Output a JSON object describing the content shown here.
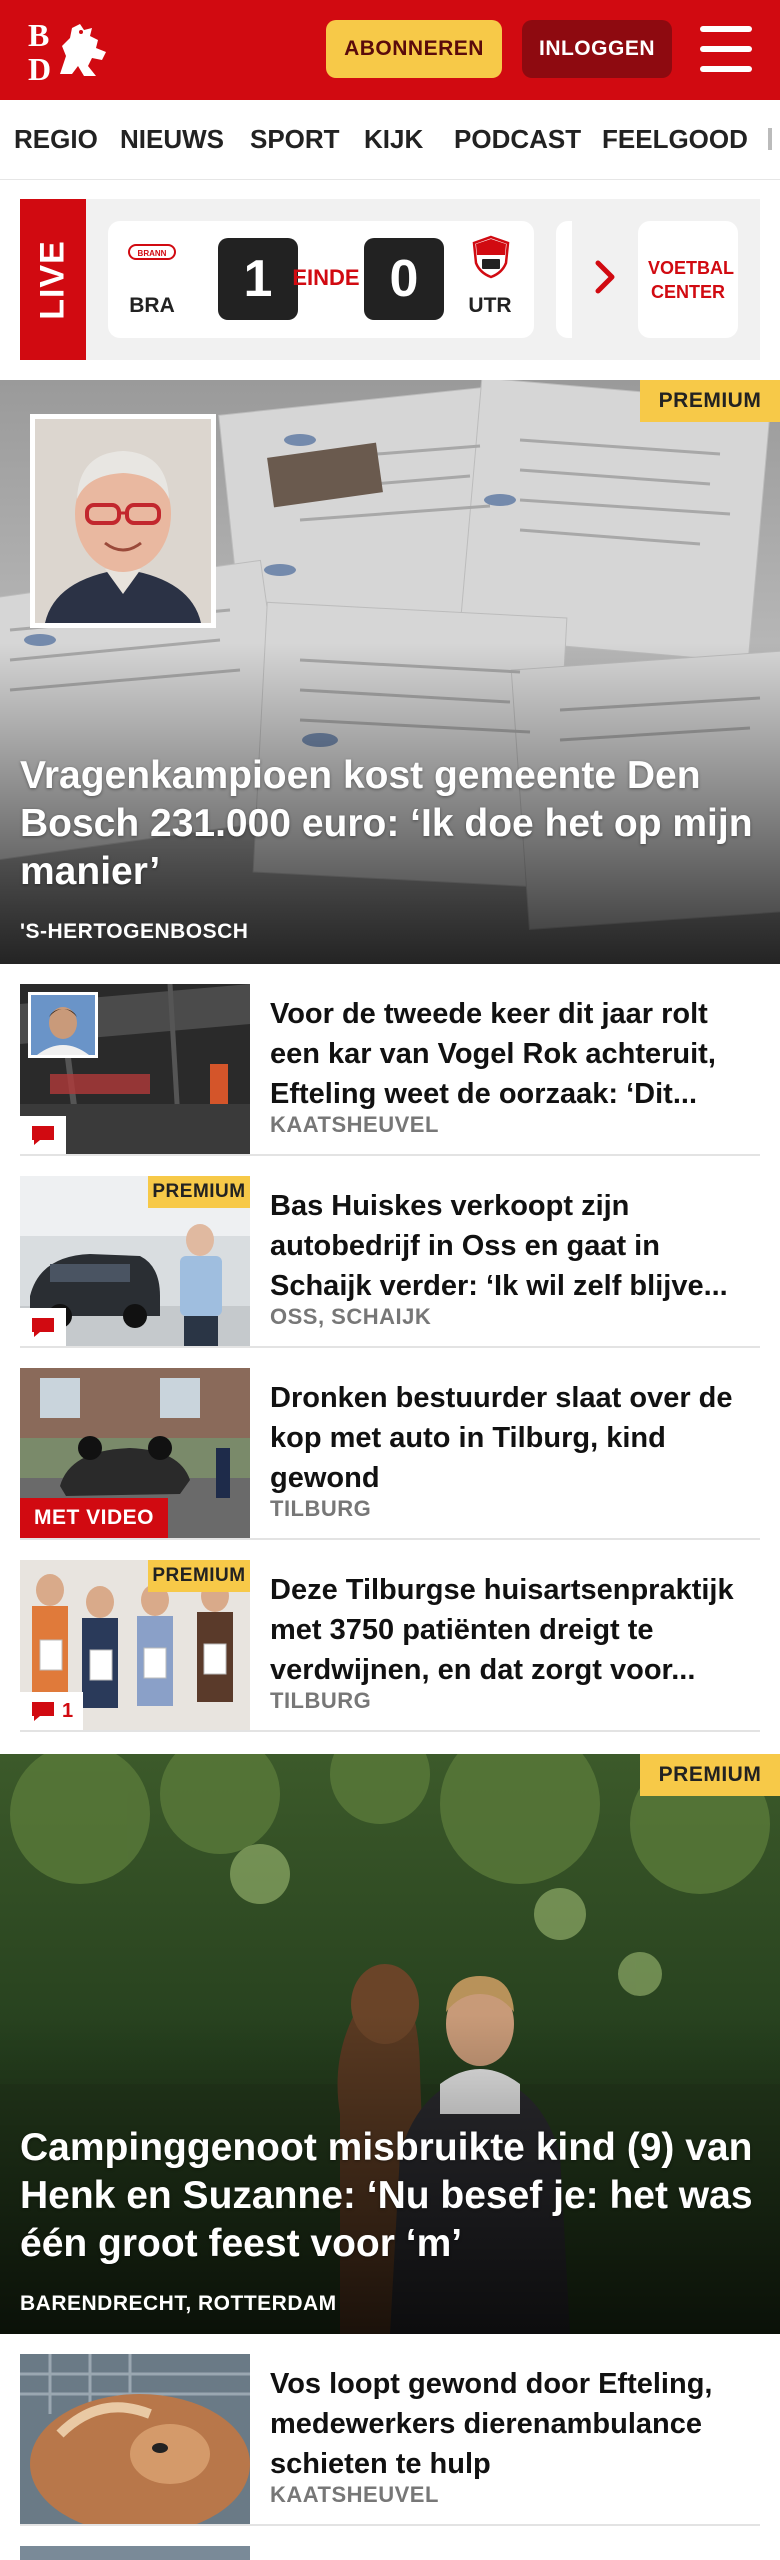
{
  "header": {
    "logo_text": "BD",
    "subscribe_label": "ABONNEREN",
    "login_label": "INLOGGEN",
    "brand_color": "#d10a11",
    "accent_color": "#f7c948"
  },
  "nav": {
    "items": [
      "REGIO",
      "NIEUWS",
      "SPORT",
      "KIJK",
      "PODCAST",
      "FEELGOOD"
    ]
  },
  "live": {
    "label": "LIVE",
    "match": {
      "home_code": "BRA",
      "home_badge": "BRANN",
      "home_score": "1",
      "status": "EINDE",
      "away_score": "0",
      "away_code": "UTR"
    },
    "voetbal_center_label": "VOETBAL CENTER"
  },
  "premium_label": "PREMIUM",
  "hero1": {
    "title": "Vragenkampioen kost gemeente Den Bosch 231.000 euro: ‘Ik doe het op mijn manier’",
    "location": "'S-HERTOGENBOSCH"
  },
  "articles": [
    {
      "title": "Voor de tweede keer dit jaar rolt een kar van Vogel Rok achteruit, Efteling weet de oorzaak: ‘Dit...",
      "location": "KAATSHEUVEL"
    },
    {
      "title": "Bas Huiskes verkoopt zijn autobedrijf in Oss en gaat in Schaijk verder: ‘Ik wil zelf blijve...",
      "location": "OSS, SCHAIJK",
      "premium": true
    },
    {
      "title": "Dronken bestuurder slaat over de kop met auto in Tilburg, kind gewond",
      "location": "TILBURG",
      "video_label": "MET VIDEO"
    },
    {
      "title": "Deze Tilburgse huisartsenprak­tijk met 3750 patiënten dreigt te verdwijnen, en dat zorgt voor...",
      "location": "TILBURG",
      "premium": true,
      "comments": "1"
    }
  ],
  "hero2": {
    "title": "Campinggenoot misbruikte kind (9) van Henk en Suzanne: ‘Nu besef je: het was één groot feest voor ‘m’",
    "location": "BARENDRECHT, ROTTERDAM"
  },
  "article5": {
    "title": "Vos loopt gewond door Efteling, medewerkers dierenambulance schieten te hulp",
    "location": "KAATSHEUVEL"
  }
}
